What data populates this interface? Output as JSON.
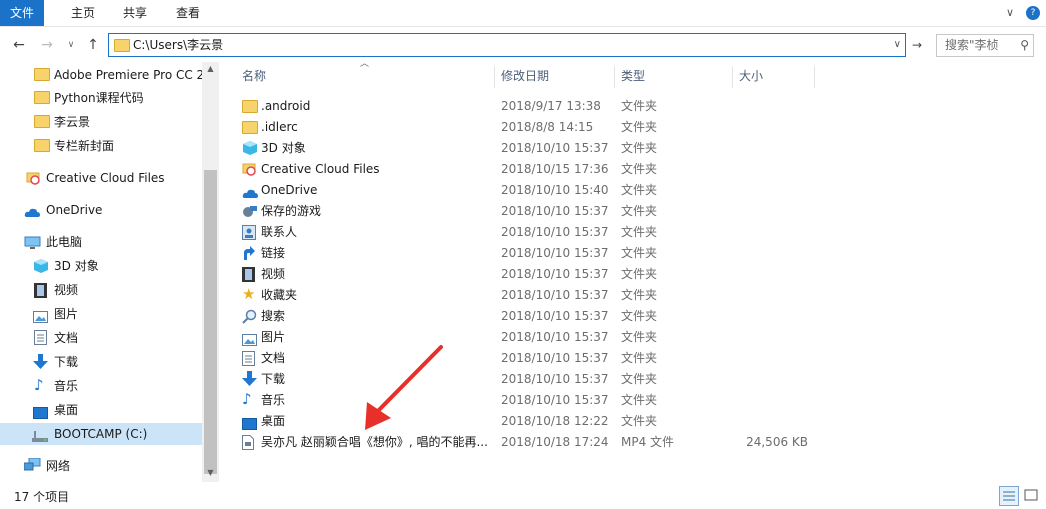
{
  "ribbon": {
    "tabs": [
      {
        "label": "文件",
        "active": true
      },
      {
        "label": "主页"
      },
      {
        "label": "共享"
      },
      {
        "label": "查看"
      }
    ],
    "accent": "#1a73c8"
  },
  "address": {
    "path": "C:\\Users\\李云景",
    "search_placeholder": "搜索\"李桢"
  },
  "sidebar": {
    "items": [
      {
        "label": "Adobe Premiere Pro CC 2",
        "icon": "folder-icon"
      },
      {
        "label": "Python课程代码",
        "icon": "folder-icon"
      },
      {
        "label": "李云景",
        "icon": "folder-icon"
      },
      {
        "label": "专栏新封面",
        "icon": "folder-icon"
      },
      {
        "label": "Creative Cloud Files",
        "icon": "creative-cloud-icon"
      },
      {
        "label": "OneDrive",
        "icon": "onedrive-icon"
      },
      {
        "label": "此电脑",
        "icon": "computer-icon"
      },
      {
        "label": "3D 对象",
        "icon": "3d-objects-icon"
      },
      {
        "label": "视频",
        "icon": "video-icon"
      },
      {
        "label": "图片",
        "icon": "pictures-icon"
      },
      {
        "label": "文档",
        "icon": "documents-icon"
      },
      {
        "label": "下载",
        "icon": "download-icon"
      },
      {
        "label": "音乐",
        "icon": "music-icon"
      },
      {
        "label": "桌面",
        "icon": "desktop-icon"
      },
      {
        "label": "BOOTCAMP (C:)",
        "icon": "drive-icon",
        "selected": true
      },
      {
        "label": "网络",
        "icon": "network-icon"
      }
    ]
  },
  "columns": {
    "name": "名称",
    "date": "修改日期",
    "type": "类型",
    "size": "大小"
  },
  "files": [
    {
      "name": ".android",
      "date": "2018/9/17 13:38",
      "type": "文件夹",
      "size": "",
      "icon": "folder-icon"
    },
    {
      "name": ".idlerc",
      "date": "2018/8/8 14:15",
      "type": "文件夹",
      "size": "",
      "icon": "folder-icon"
    },
    {
      "name": "3D 对象",
      "date": "2018/10/10 15:37",
      "type": "文件夹",
      "size": "",
      "icon": "3d-objects-icon"
    },
    {
      "name": "Creative Cloud Files",
      "date": "2018/10/15 17:36",
      "type": "文件夹",
      "size": "",
      "icon": "creative-cloud-icon"
    },
    {
      "name": "OneDrive",
      "date": "2018/10/10 15:40",
      "type": "文件夹",
      "size": "",
      "icon": "onedrive-icon"
    },
    {
      "name": "保存的游戏",
      "date": "2018/10/10 15:37",
      "type": "文件夹",
      "size": "",
      "icon": "saved-games-icon"
    },
    {
      "name": "联系人",
      "date": "2018/10/10 15:37",
      "type": "文件夹",
      "size": "",
      "icon": "contacts-icon"
    },
    {
      "name": "链接",
      "date": "2018/10/10 15:37",
      "type": "文件夹",
      "size": "",
      "icon": "links-icon"
    },
    {
      "name": "视频",
      "date": "2018/10/10 15:37",
      "type": "文件夹",
      "size": "",
      "icon": "video-icon"
    },
    {
      "name": "收藏夹",
      "date": "2018/10/10 15:37",
      "type": "文件夹",
      "size": "",
      "icon": "favorites-icon"
    },
    {
      "name": "搜索",
      "date": "2018/10/10 15:37",
      "type": "文件夹",
      "size": "",
      "icon": "searches-icon"
    },
    {
      "name": "图片",
      "date": "2018/10/10 15:37",
      "type": "文件夹",
      "size": "",
      "icon": "pictures-icon"
    },
    {
      "name": "文档",
      "date": "2018/10/10 15:37",
      "type": "文件夹",
      "size": "",
      "icon": "documents-icon"
    },
    {
      "name": "下载",
      "date": "2018/10/10 15:37",
      "type": "文件夹",
      "size": "",
      "icon": "download-icon"
    },
    {
      "name": "音乐",
      "date": "2018/10/10 15:37",
      "type": "文件夹",
      "size": "",
      "icon": "music-icon"
    },
    {
      "name": "桌面",
      "date": "2018/10/18 12:22",
      "type": "文件夹",
      "size": "",
      "icon": "desktop-icon"
    },
    {
      "name": "吴亦凡 赵丽颖合唱《想你》, 唱的不能再...",
      "date": "2018/10/18 17:24",
      "type": "MP4 文件",
      "size": "24,506 KB",
      "icon": "mp4-file-icon"
    }
  ],
  "status": {
    "item_count": "17 个项目"
  },
  "colors": {
    "selection": "#cce4f7",
    "annotation_arrow": "#e8302a"
  }
}
